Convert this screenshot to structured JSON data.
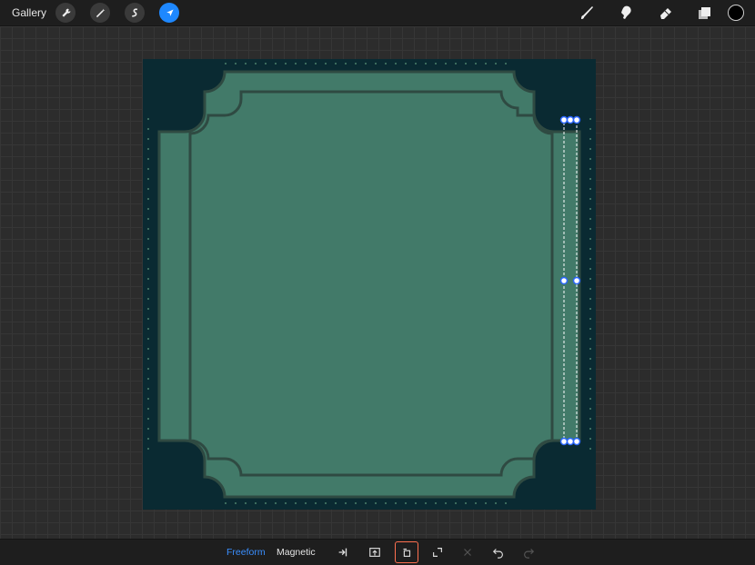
{
  "topbar": {
    "gallery_label": "Gallery",
    "tools_left": [
      {
        "icon": "wrench-icon"
      },
      {
        "icon": "magic-wand-icon"
      },
      {
        "icon": "selection-icon"
      },
      {
        "icon": "transform-arrow-icon",
        "active": true
      }
    ],
    "tools_right": [
      {
        "icon": "brush-icon"
      },
      {
        "icon": "smudge-icon"
      },
      {
        "icon": "eraser-icon"
      },
      {
        "icon": "layers-icon"
      }
    ],
    "current_color": "#000000"
  },
  "bottombar": {
    "mode_freeform": "Freeform",
    "mode_magnetic": "Magnetic",
    "actions": [
      {
        "icon": "snap-icon"
      },
      {
        "icon": "flip-icon"
      },
      {
        "icon": "rotate-icon",
        "selected": true
      },
      {
        "icon": "fit-screen-icon"
      },
      {
        "icon": "reset-icon",
        "disabled": true
      },
      {
        "icon": "undo-icon"
      },
      {
        "icon": "redo-icon",
        "disabled": true
      }
    ]
  },
  "colors": {
    "accent": "#1e88ff",
    "canvas_bg": "#0a2a32",
    "frame_fill": "#427a69",
    "frame_line": "#2f4a42",
    "selection_highlight": "#ff7050"
  }
}
